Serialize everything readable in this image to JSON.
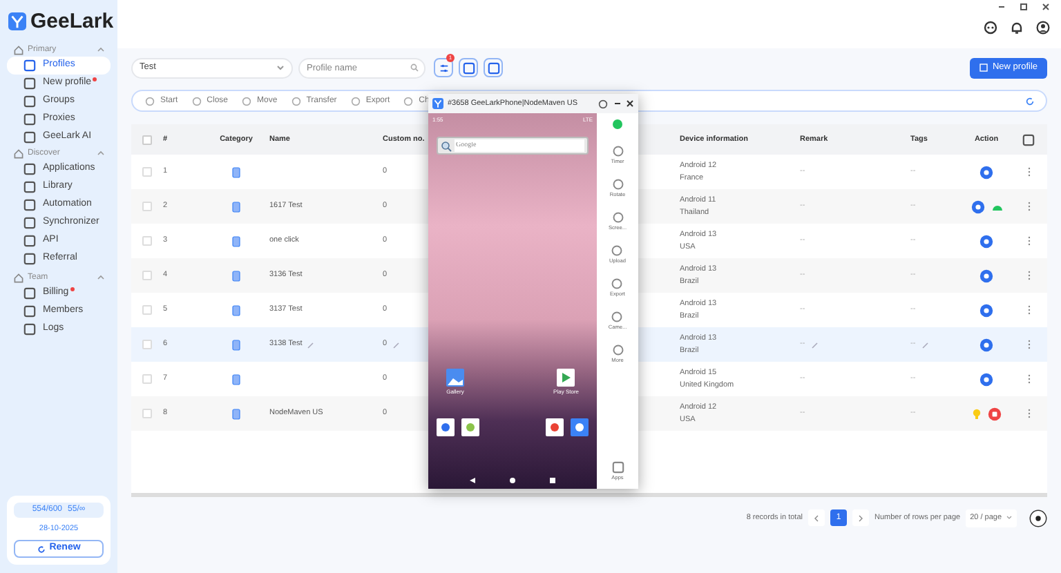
{
  "app": {
    "logo": "GeeLark"
  },
  "sidebar": {
    "sections": [
      {
        "title": "Primary",
        "expanded": true,
        "items": [
          {
            "label": "Profiles",
            "selected": true,
            "notify": false
          },
          {
            "label": "New profile",
            "selected": false,
            "notify": true
          },
          {
            "label": "Groups",
            "selected": false,
            "notify": false
          },
          {
            "label": "Proxies",
            "selected": false,
            "notify": false
          },
          {
            "label": "GeeLark AI",
            "selected": false,
            "notify": false
          }
        ]
      },
      {
        "title": "Discover",
        "expanded": true,
        "items": [
          {
            "label": "Applications",
            "selected": false,
            "notify": false
          },
          {
            "label": "Library",
            "selected": false,
            "notify": false
          },
          {
            "label": "Automation",
            "selected": false,
            "notify": false
          },
          {
            "label": "Synchronizer",
            "selected": false,
            "notify": false
          },
          {
            "label": "API",
            "selected": false,
            "notify": false
          },
          {
            "label": "Referral",
            "selected": false,
            "notify": false
          }
        ]
      },
      {
        "title": "Team",
        "expanded": true,
        "items": [
          {
            "label": "Billing",
            "selected": false,
            "notify": true
          },
          {
            "label": "Members",
            "selected": false,
            "notify": false
          },
          {
            "label": "Logs",
            "selected": false,
            "notify": false
          }
        ]
      }
    ],
    "plan": {
      "profiles": "554/600",
      "members": "55/∞",
      "date": "28-10-2025",
      "renew": "Renew"
    }
  },
  "filters": {
    "group": "Test",
    "search_placeholder": "Profile name",
    "filter_badge": "1",
    "new_profile": "New profile"
  },
  "toolbar": [
    "Start",
    "Close",
    "Move",
    "Transfer",
    "Export",
    "Ch"
  ],
  "table": {
    "header_checked": false,
    "columns": [
      "#",
      "Category",
      "Name",
      "Custom no.",
      "Device information",
      "Remark",
      "Tags",
      "Action"
    ],
    "rows": [
      {
        "number": "1",
        "name": "",
        "custom_no": "0",
        "android": "Android 12",
        "country": "France",
        "remark": "--",
        "tags": "--",
        "highlighted": false,
        "checked": false,
        "kind": "start"
      },
      {
        "number": "2",
        "name": "1617 Test",
        "custom_no": "0",
        "android": "Android 11",
        "country": "Thailand",
        "remark": "--",
        "tags": "--",
        "highlighted": false,
        "checked": false,
        "kind": "start-android"
      },
      {
        "number": "3",
        "name": "one click",
        "custom_no": "0",
        "android": "Android 13",
        "country": "USA",
        "remark": "--",
        "tags": "--",
        "highlighted": false,
        "checked": false,
        "kind": "start"
      },
      {
        "number": "4",
        "name": "3136 Test",
        "custom_no": "0",
        "android": "Android 13",
        "country": "Brazil",
        "remark": "--",
        "tags": "--",
        "highlighted": false,
        "checked": false,
        "kind": "start"
      },
      {
        "number": "5",
        "name": "3137 Test",
        "custom_no": "0",
        "android": "Android 13",
        "country": "Brazil",
        "remark": "--",
        "tags": "--",
        "highlighted": false,
        "checked": false,
        "kind": "start"
      },
      {
        "number": "6",
        "name": "3138 Test",
        "custom_no": "0",
        "android": "Android 13",
        "country": "Brazil",
        "remark": "--",
        "tags": "--",
        "highlighted": true,
        "checked": false,
        "kind": "start"
      },
      {
        "number": "7",
        "name": "",
        "custom_no": "0",
        "android": "Android 15",
        "country": "United Kingdom",
        "remark": "--",
        "tags": "--",
        "highlighted": false,
        "checked": false,
        "kind": "start"
      },
      {
        "number": "8",
        "name": "NodeMaven US",
        "custom_no": "0",
        "android": "Android 12",
        "country": "USA",
        "remark": "--",
        "tags": "--",
        "highlighted": false,
        "checked": false,
        "kind": "running"
      }
    ]
  },
  "pagination": {
    "total": "8 records in total",
    "page": "1",
    "rows_label": "Number of rows per page",
    "per_page": "20 / page"
  },
  "phone": {
    "title": "#3658 GeeLarkPhone|NodeMaven US",
    "time": "1:55",
    "network": "LTE",
    "search_placeholder": "Google",
    "apps": [
      "Gallery",
      "Play Store"
    ],
    "tools": [
      "Timer",
      "Rotate",
      "Scree...",
      "Upload",
      "Export",
      "Came...",
      "More"
    ],
    "apps_button": "Apps"
  }
}
